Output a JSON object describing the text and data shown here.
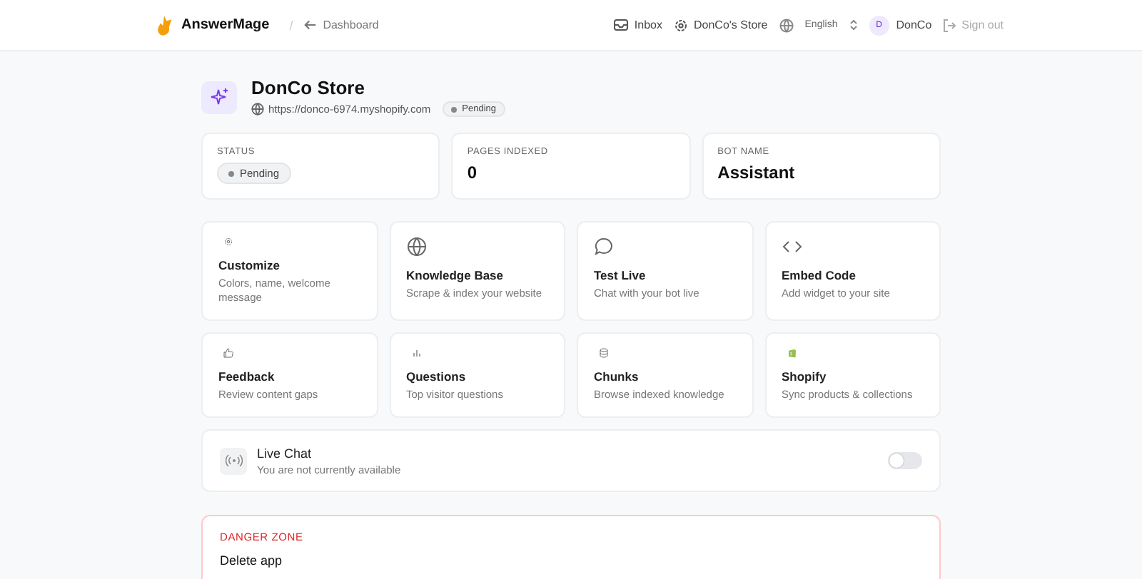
{
  "header": {
    "brand": "AnswerMage",
    "separator": "/",
    "back_link": "Dashboard",
    "inbox": "Inbox",
    "store": "DonCo's Store",
    "language": "English",
    "user_initial": "D",
    "user_name": "DonCo",
    "sign_out": "Sign out"
  },
  "store": {
    "name": "DonCo Store",
    "url": "https://donco-6974.myshopify.com",
    "status": "Pending"
  },
  "stats": [
    {
      "label": "STATUS",
      "kind": "badge",
      "value": "Pending"
    },
    {
      "label": "PAGES INDEXED",
      "kind": "text",
      "value": "0"
    },
    {
      "label": "BOT NAME",
      "kind": "text",
      "value": "Assistant"
    }
  ],
  "actions": [
    {
      "kind": "gear",
      "title": "Customize",
      "desc": "Colors, name, welcome message"
    },
    {
      "kind": "globe",
      "title": "Knowledge Base",
      "desc": "Scrape & index your website"
    },
    {
      "kind": "chat",
      "title": "Test Live",
      "desc": "Chat with your bot live"
    },
    {
      "kind": "code",
      "title": "Embed Code",
      "desc": "Add widget to your site"
    },
    {
      "kind": "thumb",
      "title": "Feedback",
      "desc": "Review content gaps"
    },
    {
      "kind": "bars",
      "title": "Questions",
      "desc": "Top visitor questions"
    },
    {
      "kind": "database",
      "title": "Chunks",
      "desc": "Browse indexed knowledge"
    },
    {
      "kind": "bag",
      "title": "Shopify",
      "desc": "Sync products & collections"
    }
  ],
  "live_chat": {
    "title": "Live Chat",
    "subtitle": "You are not currently available",
    "on": false
  },
  "danger_zone": {
    "title": "DANGER ZONE",
    "item": "Delete app"
  }
}
